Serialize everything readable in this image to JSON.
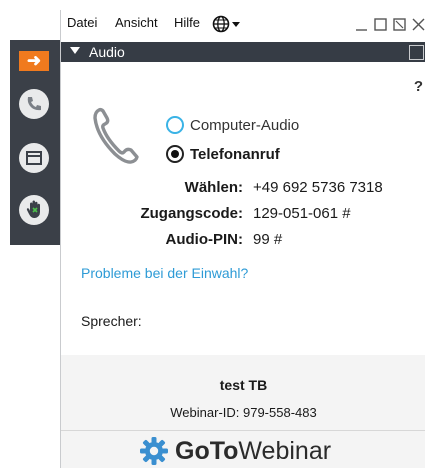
{
  "menu": {
    "file": "Datei",
    "view": "Ansicht",
    "help": "Hilfe"
  },
  "section": {
    "title": "Audio",
    "help_glyph": "?"
  },
  "audio_options": {
    "computer": "Computer-Audio",
    "phone": "Telefonanruf",
    "selected": "phone"
  },
  "dial_info": {
    "dial_label": "Wählen:",
    "dial_value": "+49 692 5736 7318",
    "code_label": "Zugangscode:",
    "code_value": "129-051-061 #",
    "pin_label": "Audio-PIN:",
    "pin_value": "99 #"
  },
  "trouble_link": "Probleme bei der Einwahl?",
  "speaker_label": "Sprecher:",
  "footer": {
    "user": "test TB",
    "webinar_id": "Webinar-ID: 979-558-483"
  },
  "brand": {
    "goto": "GoTo",
    "product": "Webinar"
  },
  "colors": {
    "rail_bg": "#3b4048",
    "accent_orange": "#f07a1e",
    "header_bg": "#363c45",
    "link_blue": "#2e9bd6",
    "radio_blue": "#3ab3e6",
    "logo_blue": "#3a8fd0"
  },
  "icons": {
    "rail": [
      "arrow-right-icon",
      "phone-icon",
      "window-icon",
      "hand-icon"
    ],
    "menu_globe": "globe-icon"
  }
}
